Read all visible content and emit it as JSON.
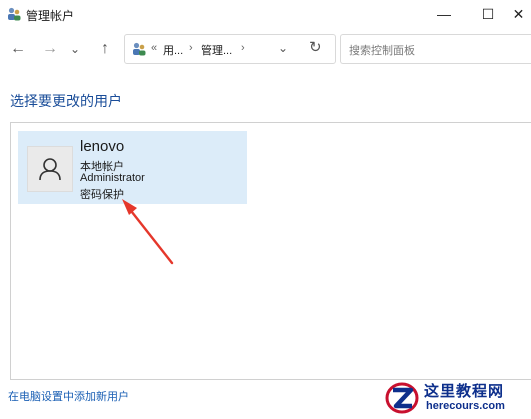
{
  "window": {
    "title": "管理帐户",
    "minimize_glyph": "—",
    "maximize_glyph": "☐",
    "close_glyph": "✕"
  },
  "nav": {
    "back_glyph": "←",
    "forward_glyph": "→",
    "history_glyph": "⌄",
    "up_glyph": "↑",
    "breadcrumb_prefix": "«",
    "breadcrumb": [
      "用...",
      "管理..."
    ],
    "breadcrumb_sep": "›",
    "dropdown_glyph": "⌄",
    "refresh_glyph": "↻",
    "search_placeholder": "搜索控制面板"
  },
  "main": {
    "heading": "选择要更改的用户",
    "users": [
      {
        "name": "lenovo",
        "lines": [
          "本地帐户",
          "Administrator",
          "密码保护"
        ]
      }
    ],
    "add_user_link": "在电脑设置中添加新用户"
  },
  "watermark": {
    "cn": "这里教程网",
    "en": "herecours.com"
  },
  "colors": {
    "heading": "#1a4d99",
    "card_bg": "#dcecf9",
    "link": "#1a5fb4",
    "arrow": "#e5372b",
    "watermark": "#0d2f8c"
  }
}
